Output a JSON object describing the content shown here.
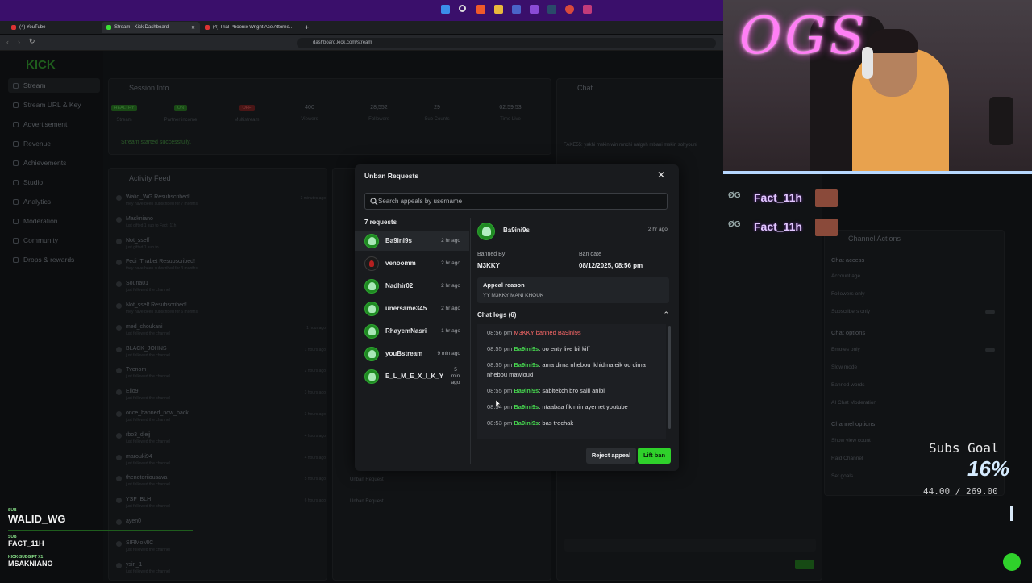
{
  "browser": {
    "tabs": [
      {
        "label": "(4) YouTube",
        "color": "#d33"
      },
      {
        "label": "Stream - Kick Dashboard",
        "color": "#3ae035"
      },
      {
        "label": "(4) Trial Phoenix Wright Ace Attorne...",
        "color": "#d33"
      }
    ],
    "url": "dashboard.kick.com/stream"
  },
  "sidebar": {
    "logo": "KICK",
    "items": [
      {
        "label": "Stream"
      },
      {
        "label": "Stream URL & Key"
      },
      {
        "label": "Advertisement"
      },
      {
        "label": "Revenue"
      },
      {
        "label": "Achievements"
      },
      {
        "label": "Studio"
      },
      {
        "label": "Analytics"
      },
      {
        "label": "Moderation"
      },
      {
        "label": "Community"
      },
      {
        "label": "Drops & rewards"
      }
    ]
  },
  "session": {
    "title": "Session Info",
    "stats": [
      {
        "value": "HEALTHY",
        "label": "Stream"
      },
      {
        "value": "ON",
        "label": "Partner income"
      },
      {
        "value": "OFF",
        "label": "Multistream"
      },
      {
        "value": "400",
        "label": "Viewers"
      },
      {
        "value": "28,552",
        "label": "Followers"
      },
      {
        "value": "29",
        "label": "Sub Counts"
      },
      {
        "value": "02:59:53",
        "label": "Time Live"
      }
    ],
    "status": "Stream started successfully."
  },
  "feed": {
    "title": "Activity Feed",
    "rows": [
      {
        "a": "Walid_WG Resubscribed!",
        "b": "they have been subscribed for 7 months",
        "t": "3 minutes ago"
      },
      {
        "a": "Maskniano",
        "b": "just gifted 1 sub to Fact_11h",
        "t": ""
      },
      {
        "a": "Not_sself",
        "b": "just gifted 1 sub to ",
        "t": ""
      },
      {
        "a": "Fedi_Thabet Resubscribed!",
        "b": "they have been subscribed for 3 months",
        "t": ""
      },
      {
        "a": "Souna01",
        "b": "just followed the channel",
        "t": ""
      },
      {
        "a": "Not_sself Resubscribed!",
        "b": "they have been subscribed for 6 months",
        "t": ""
      },
      {
        "a": "med_choukani",
        "b": "just followed the channel",
        "t": "1 hour ago"
      },
      {
        "a": "BLACK_JOHNS",
        "b": "just followed the channel",
        "t": "1 hours ago"
      },
      {
        "a": "Tvenom",
        "b": "just followed the channel",
        "t": "2 hours ago"
      },
      {
        "a": "Ello9",
        "b": "just followed the channel",
        "t": "3 hours ago"
      },
      {
        "a": "once_banned_now_back",
        "b": "just followed the channel",
        "t": "3 hours ago"
      },
      {
        "a": "rbo3_djejj",
        "b": "just followed the channel",
        "t": "4 hours ago"
      },
      {
        "a": "marouki94",
        "b": "just followed the channel",
        "t": "4 hours ago"
      },
      {
        "a": "thenotoriiousava",
        "b": "just followed the channel",
        "t": "5 hours ago"
      },
      {
        "a": "YSF_BLH",
        "b": "just followed the channel",
        "t": "6 hours ago"
      },
      {
        "a": "ayen0",
        "b": "",
        "t": ""
      },
      {
        "a": "SIRMoMIC",
        "b": "just followed the channel",
        "t": ""
      },
      {
        "a": "ysin_1",
        "b": "just followed the channel",
        "t": ""
      }
    ]
  },
  "chatpanel": {
    "title": "Chat",
    "line": "FAKE55: yakhi mskin win mnchi nalgeh mbani mskin sohyouni"
  },
  "channel_actions": {
    "title": "Channel Actions",
    "chat_access": "Chat access",
    "rows1": [
      "Account age",
      "Followers only",
      "Subscribers only"
    ],
    "chat_options": "Chat options",
    "rows2": [
      "Emotes only",
      "Slow mode",
      "Banned words",
      "AI Chat Moderation"
    ],
    "channel_options": "Channel options",
    "rows3": [
      "Show view count",
      "Raid Channel",
      "Set goals"
    ]
  },
  "overlay": {
    "neon": "OGS",
    "fact_rows": [
      "Fact_11h",
      "Fact_11h"
    ],
    "subs_goal_label": "Subs Goal",
    "subs_goal_pct": "16%",
    "subs_goal_count": "44.00 / 269.00",
    "sub_labels": [
      {
        "tag": "SUB",
        "name": "WALID_WG"
      },
      {
        "tag": "SUB",
        "name": "FACT_11H"
      },
      {
        "tag": "KICK-SUBGIFT X1",
        "name": "MSAKNIANO"
      }
    ]
  },
  "modal": {
    "title": "Unban Requests",
    "search_placeholder": "Search appeals by username",
    "requests_count": "7 requests",
    "requests": [
      {
        "name": "Ba9ini9s",
        "time": "2 hr ago",
        "avatar": "green"
      },
      {
        "name": "venoomm",
        "time": "2 hr ago",
        "avatar": "red"
      },
      {
        "name": "Nadhir02",
        "time": "2 hr ago",
        "avatar": "green"
      },
      {
        "name": "unersame345",
        "time": "2 hr ago",
        "avatar": "green"
      },
      {
        "name": "RhayemNasri",
        "time": "1 hr ago",
        "avatar": "green"
      },
      {
        "name": "youBstream",
        "time": "9 min ago",
        "avatar": "green"
      },
      {
        "name": "E_L_M_E_X_I_K_Y",
        "time": "5 min ago",
        "avatar": "green"
      }
    ],
    "detail": {
      "username": "Ba9ini9s",
      "time": "2 hr ago",
      "banned_by_label": "Banned By",
      "banned_by": "M3KKY",
      "ban_date_label": "Ban date",
      "ban_date": "08/12/2025, 08:56 pm",
      "appeal_label": "Appeal reason",
      "appeal_reason": "YY M3KKY MANI KHOUK",
      "chat_logs_label": "Chat logs (6)",
      "logs": [
        {
          "time": "08:56 pm",
          "user": "",
          "msg": "M3KKY banned Ba9ini9s",
          "ban": true
        },
        {
          "time": "08:55 pm",
          "user": "Ba9ini9s",
          "msg": ": oo enty live bil kiff"
        },
        {
          "time": "08:55 pm",
          "user": "Ba9ini9s",
          "msg": ": ama dima nhebou lkhidma eik oo dima nhebou mawjoud"
        },
        {
          "time": "08:55 pm",
          "user": "Ba9ini9s",
          "msg": ": sabitekch bro salli anibi"
        },
        {
          "time": "08:54 pm",
          "user": "Ba9ini9s",
          "msg": ": ntaabaa fik min ayemet youtube"
        },
        {
          "time": "08:53 pm",
          "user": "Ba9ini9s",
          "msg": ": bas trechak"
        }
      ]
    },
    "reject_label": "Reject appeal",
    "lift_label": "Lift ban"
  }
}
